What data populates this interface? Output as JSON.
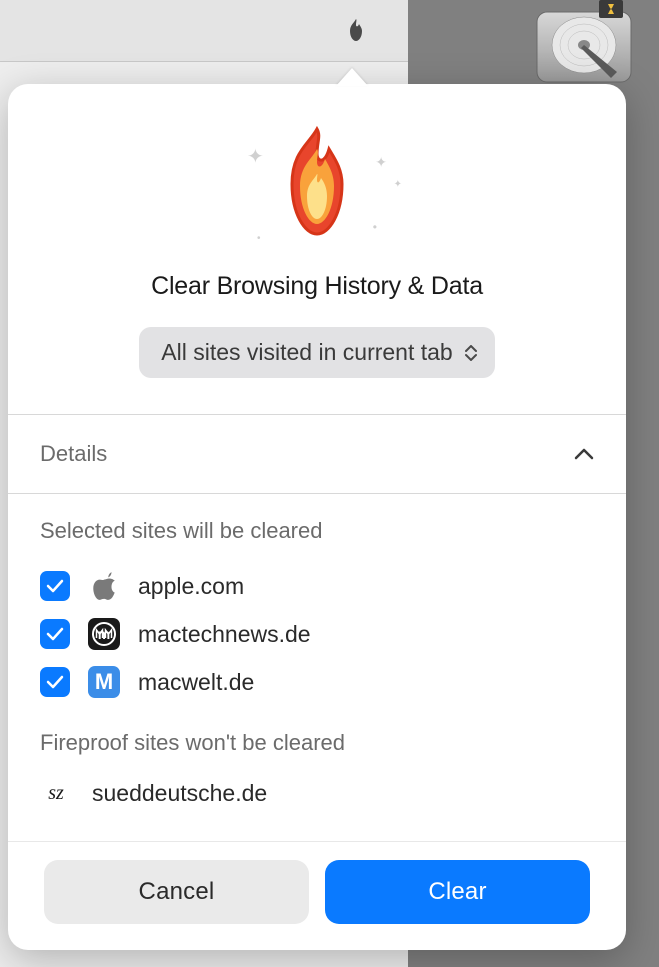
{
  "toolbar": {
    "fire_button": "fire"
  },
  "popup": {
    "title": "Clear Browsing History & Data",
    "dropdown_label": "All sites visited in current tab",
    "details_label": "Details",
    "selected_sites_label": "Selected sites will be cleared",
    "sites": [
      {
        "domain": "apple.com",
        "checked": true,
        "icon": "apple"
      },
      {
        "domain": "mactechnews.de",
        "checked": true,
        "icon": "mactech"
      },
      {
        "domain": "macwelt.de",
        "checked": true,
        "icon": "macwelt"
      }
    ],
    "fireproof_label": "Fireproof sites won't be cleared",
    "fireproof_sites": [
      {
        "domain": "sueddeutsche.de",
        "icon": "sz"
      }
    ],
    "cancel_label": "Cancel",
    "clear_label": "Clear"
  }
}
